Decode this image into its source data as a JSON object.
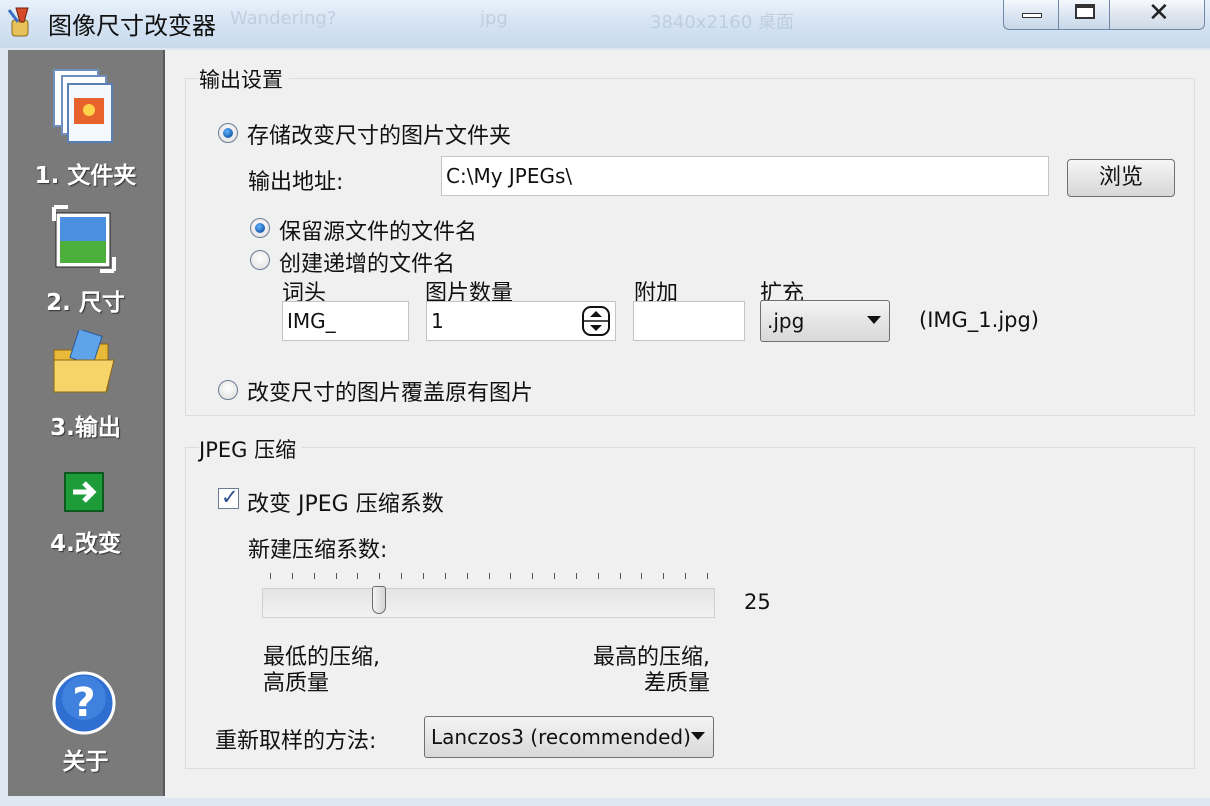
{
  "window": {
    "title": "图像尺寸改变器",
    "background_titles": [
      "Wandering?",
      "jpg",
      "3840x2160 桌面"
    ]
  },
  "sidebar": {
    "items": [
      {
        "label": "1. 文件夹",
        "icon": "folder-images-icon"
      },
      {
        "label": "2. 尺寸",
        "icon": "resize-picture-icon"
      },
      {
        "label": "3.输出",
        "icon": "output-folder-icon"
      },
      {
        "label": "4.改变",
        "icon": "green-arrow-icon"
      },
      {
        "label": "关于",
        "icon": "help-icon"
      }
    ]
  },
  "output_settings": {
    "group_title": "输出设置",
    "radio_folder_label": "存储改变尺寸的图片文件夹",
    "output_path_label": "输出地址:",
    "output_path_value": "C:\\My JPEGs\\",
    "browse_label": "浏览",
    "keep_name_label": "保留源文件的文件名",
    "incremental_name_label": "创建递增的文件名",
    "prefix_label": "词头",
    "prefix_value": "IMG_",
    "count_label": "图片数量",
    "count_value": "1",
    "suffix_label": "附加",
    "suffix_value": "",
    "extension_label": "扩充",
    "extension_value": ".jpg",
    "example_filename": "(IMG_1.jpg)",
    "overwrite_label": "改变尺寸的图片覆盖原有图片",
    "selected_mode": "folder",
    "selected_name_mode": "keep"
  },
  "jpeg": {
    "group_title": "JPEG 压缩",
    "change_compression_label": "改变 JPEG 压缩系数",
    "change_compression_checked": true,
    "new_factor_label": "新建压缩系数:",
    "slider_value": 25,
    "slider_min": 0,
    "slider_max": 100,
    "slider_value_text": "25",
    "low_label_line1": "最低的压缩,",
    "low_label_line2": "高质量",
    "high_label_line1": "最高的压缩,",
    "high_label_line2": "差质量",
    "resample_label": "重新取样的方法:",
    "resample_value": "Lanczos3 (recommended)"
  },
  "colors": {
    "sidebar_bg": "#7a7a7a",
    "panel_bg": "#f0f0f0",
    "radio_accent": "#1a5fb0"
  }
}
